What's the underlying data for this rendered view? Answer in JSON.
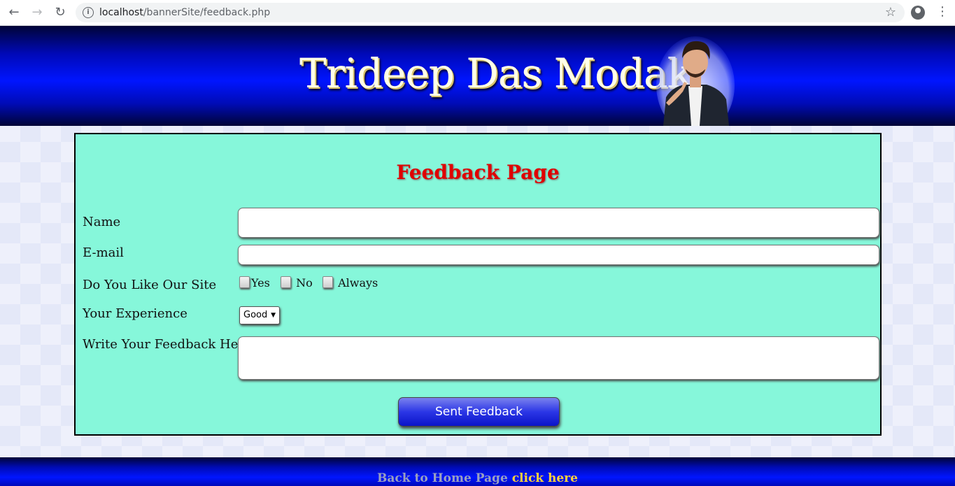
{
  "browser": {
    "url_host": "localhost",
    "url_path": "/bannerSite/feedback.php"
  },
  "header": {
    "title": "Trideep Das Modak"
  },
  "form": {
    "heading": "Feedback Page",
    "name_label": "Name",
    "name_value": "",
    "email_label": "E-mail",
    "email_value": "",
    "like_label": "Do You Like Our Site",
    "like_options": [
      "Yes",
      "No",
      "Always"
    ],
    "experience_label": "Your Experience",
    "experience_selected": "Good",
    "feedback_label": "Write Your Feedback Here",
    "feedback_value": "",
    "submit_label": "Sent Feedback"
  },
  "footer": {
    "text": "Back to Home Page",
    "link_text": "click here"
  }
}
